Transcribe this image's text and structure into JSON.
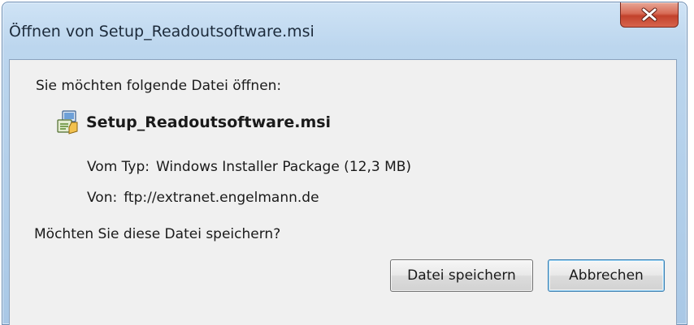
{
  "window": {
    "title": "Öffnen von Setup_Readoutsoftware.msi"
  },
  "dialog": {
    "prompt": "Sie möchten folgende Datei öffnen:",
    "file_name": "Setup_Readoutsoftware.msi",
    "type_label": "Vom Typ:",
    "type_value": "Windows Installer Package (12,3 MB)",
    "from_label": "Von:",
    "from_value": "ftp://extranet.engelmann.de",
    "question": "Möchten Sie diese Datei speichern?"
  },
  "buttons": {
    "save_label": "Datei speichern",
    "cancel_label": "Abbrechen"
  },
  "icons": {
    "file": "installer-package-icon",
    "close": "close-icon"
  },
  "colors": {
    "close_button": "#c2422c",
    "frame": "#a9c8e6",
    "client_bg": "#f0f0f0"
  }
}
